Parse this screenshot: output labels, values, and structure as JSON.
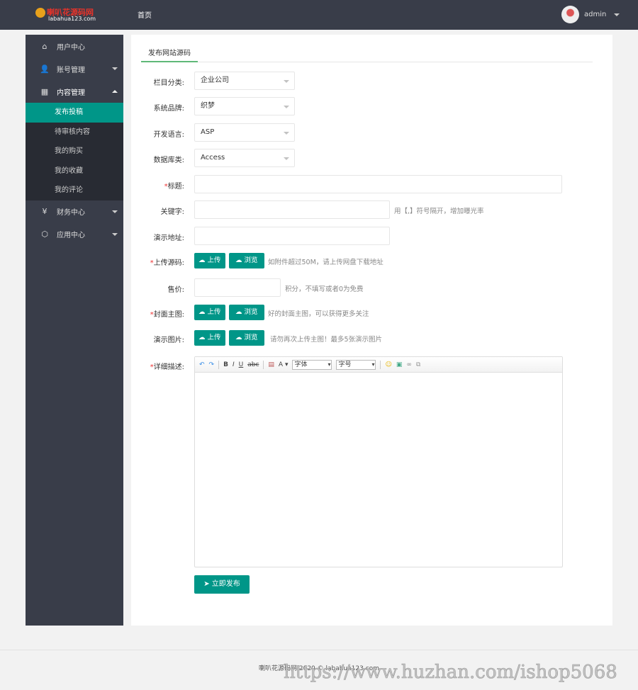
{
  "header": {
    "logo_text": "喇叭花源码网",
    "logo_domain": "labahua123.com",
    "nav_home": "首页",
    "user": "admin"
  },
  "sidebar": {
    "items": [
      {
        "label": "用户中心",
        "icon": "home-icon"
      },
      {
        "label": "账号管理",
        "icon": "user-icon"
      },
      {
        "label": "内容管理",
        "icon": "grid-icon"
      }
    ],
    "sub_items": [
      "发布投稿",
      "待审核内容",
      "我的购买",
      "我的收藏",
      "我的评论"
    ],
    "items_after": [
      {
        "label": "财务中心",
        "icon": "yen-icon"
      },
      {
        "label": "应用中心",
        "icon": "cube-icon"
      }
    ]
  },
  "main": {
    "tab": "发布网站源码",
    "fields": {
      "category": {
        "label": "栏目分类:",
        "value": "企业公司"
      },
      "brand": {
        "label": "系统品牌:",
        "value": "织梦"
      },
      "language": {
        "label": "开发语言:",
        "value": "ASP"
      },
      "database": {
        "label": "数据库类:",
        "value": "Access"
      },
      "title": {
        "label": "标题:",
        "value": ""
      },
      "keywords": {
        "label": "关键字:",
        "value": "",
        "hint": "用【,】符号隔开，增加曝光率"
      },
      "demo_url": {
        "label": "演示地址:",
        "value": ""
      },
      "source": {
        "label": "上传源码:",
        "hint": "如附件超过50M，请上传网盘下载地址"
      },
      "price": {
        "label": "售价:",
        "value": "",
        "hint": "积分，不填写或者0为免费"
      },
      "cover": {
        "label": "封面主图:",
        "hint": "好的封面主图，可以获得更多关注"
      },
      "demo_images": {
        "label": "演示图片:",
        "hint": "请勿再次上传主图！最多5张演示图片"
      },
      "description": {
        "label": "详细描述:"
      }
    },
    "upload_label": "上传",
    "browse_label": "浏览",
    "required_mark": "*",
    "editor": {
      "bold": "B",
      "italic": "I",
      "underline": "U",
      "strike": "abc",
      "font_color": "A",
      "font_family": "字体",
      "font_size": "字号"
    },
    "submit": "立即发布"
  },
  "footer": {
    "text": "喇叭花源码网 2020 © labahua123.com",
    "watermark": "https://www.huzhan.com/ishop5068"
  }
}
